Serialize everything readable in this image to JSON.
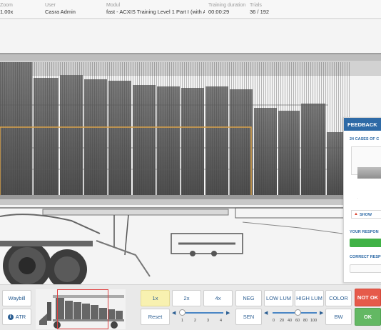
{
  "header": {
    "zoom": {
      "label": "Zoom",
      "value": "1.00x"
    },
    "user": {
      "label": "User",
      "value": "Casra Admin"
    },
    "module": {
      "label": "Modul",
      "value": "fast - ACXIS Training Level 1 Part I (with AT..."
    },
    "duration": {
      "label": "Training duration",
      "value": "00:00:29"
    },
    "trials": {
      "label": "Trials",
      "value": "36 / 192"
    }
  },
  "feedback": {
    "title": "FEEDBACK",
    "cases_label": "24 CASES OF C",
    "show_label": "SHOW",
    "your_response_label": "YOUR RESPON",
    "correct_response_label": "CORRECT RESP",
    "response_color": "#40b246"
  },
  "toolbar": {
    "waybill": "Waybill",
    "atr": "ATR",
    "zoom_1x": "1x",
    "zoom_2x": "2x",
    "zoom_4x": "4x",
    "reset": "Reset",
    "neg": "NEG",
    "sen": "SEN",
    "low_lum": "LOW LUM",
    "high_lum": "HIGH LUM",
    "color": "COLOR",
    "bw": "BW",
    "not_ok": "NOT OK",
    "ok": "OK"
  },
  "zoom_slider": {
    "ticks": [
      "1",
      "2",
      "3",
      "4"
    ],
    "level": 1
  },
  "lum_slider": {
    "ticks": [
      "0",
      "20",
      "40",
      "60",
      "80",
      "100"
    ],
    "level": 60
  },
  "colors": {
    "accent": "#2c5f93",
    "not_ok": "#e65a4a",
    "ok": "#63b863",
    "active": "#f8f1b0",
    "highlight": "#d9a24a"
  }
}
